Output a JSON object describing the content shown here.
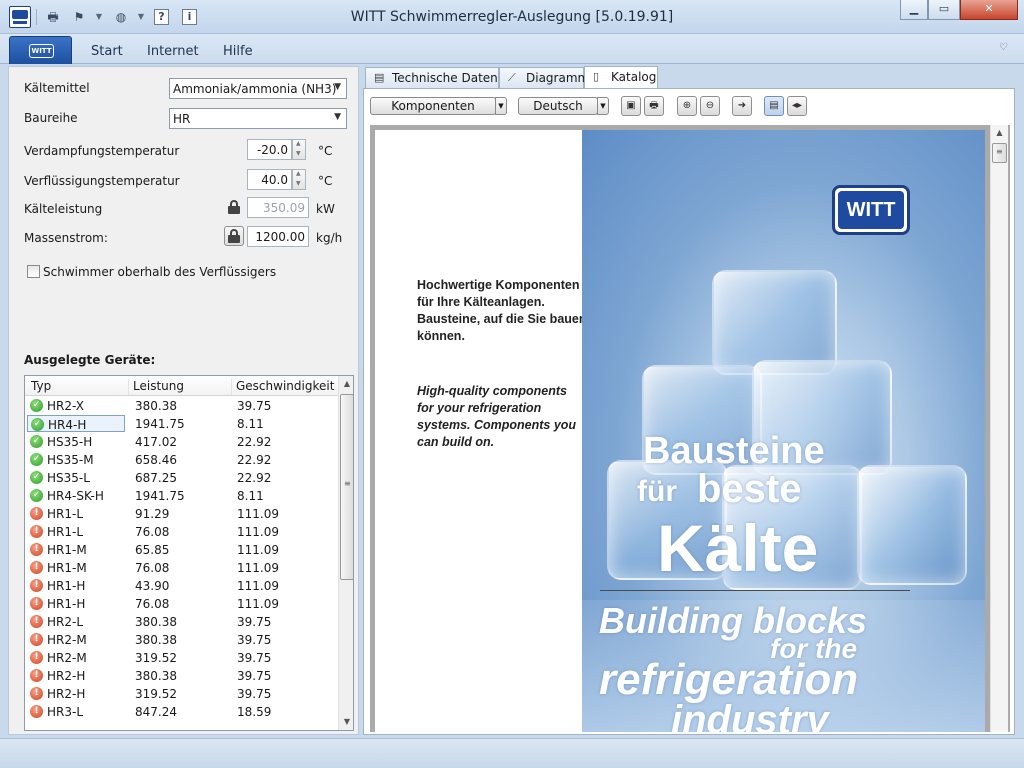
{
  "window": {
    "title": "WITT Schwimmerregler-Auslegung [5.0.19.91]"
  },
  "ribbon": {
    "app_logo": "WITT",
    "tabs": [
      "Start",
      "Internet",
      "Hilfe"
    ]
  },
  "form": {
    "kaeltemittel": {
      "label": "Kältemittel",
      "value": "Ammoniak/ammonia (NH3)"
    },
    "baureihe": {
      "label": "Baureihe",
      "value": "HR"
    },
    "verdampfung": {
      "label": "Verdampfungstemperatur",
      "value": "-20.0",
      "unit": "°C"
    },
    "verfluessigung": {
      "label": "Verflüssigungstemperatur",
      "value": "40.0",
      "unit": "°C"
    },
    "kaelteleistung": {
      "label": "Kälteleistung",
      "value": "350.09",
      "unit": "kW"
    },
    "massenstrom": {
      "label": "Massenstrom:",
      "value": "1200.00",
      "unit": "kg/h"
    },
    "schwimmer": {
      "label": "Schwimmer oberhalb des Verflüssigers",
      "checked": false
    }
  },
  "devices": {
    "title": "Ausgelegte Geräte:",
    "columns": [
      "Typ",
      "Leistung",
      "Geschwindigkeit"
    ],
    "rows": [
      {
        "typ": "HR2-X",
        "leistung": "380.38",
        "speed": "39.75",
        "status": "ok"
      },
      {
        "typ": "HR4-H",
        "leistung": "1941.75",
        "speed": "8.11",
        "status": "ok",
        "selected": true
      },
      {
        "typ": "HS35-H",
        "leistung": "417.02",
        "speed": "22.92",
        "status": "ok"
      },
      {
        "typ": "HS35-M",
        "leistung": "658.46",
        "speed": "22.92",
        "status": "ok"
      },
      {
        "typ": "HS35-L",
        "leistung": "687.25",
        "speed": "22.92",
        "status": "ok"
      },
      {
        "typ": "HR4-SK-H",
        "leistung": "1941.75",
        "speed": "8.11",
        "status": "ok"
      },
      {
        "typ": "HR1-L",
        "leistung": "91.29",
        "speed": "111.09",
        "status": "err"
      },
      {
        "typ": "HR1-L",
        "leistung": "76.08",
        "speed": "111.09",
        "status": "err"
      },
      {
        "typ": "HR1-M",
        "leistung": "65.85",
        "speed": "111.09",
        "status": "err"
      },
      {
        "typ": "HR1-M",
        "leistung": "76.08",
        "speed": "111.09",
        "status": "err"
      },
      {
        "typ": "HR1-H",
        "leistung": "43.90",
        "speed": "111.09",
        "status": "err"
      },
      {
        "typ": "HR1-H",
        "leistung": "76.08",
        "speed": "111.09",
        "status": "err"
      },
      {
        "typ": "HR2-L",
        "leistung": "380.38",
        "speed": "39.75",
        "status": "err"
      },
      {
        "typ": "HR2-M",
        "leistung": "380.38",
        "speed": "39.75",
        "status": "err"
      },
      {
        "typ": "HR2-M",
        "leistung": "319.52",
        "speed": "39.75",
        "status": "err"
      },
      {
        "typ": "HR2-H",
        "leistung": "380.38",
        "speed": "39.75",
        "status": "err"
      },
      {
        "typ": "HR2-H",
        "leistung": "319.52",
        "speed": "39.75",
        "status": "err"
      },
      {
        "typ": "HR3-L",
        "leistung": "847.24",
        "speed": "18.59",
        "status": "err"
      }
    ]
  },
  "doc_tabs": [
    {
      "label": "Technische Daten",
      "icon": "table-icon"
    },
    {
      "label": "Diagramm",
      "icon": "chart-icon"
    },
    {
      "label": "Katalog",
      "icon": "document-icon",
      "active": true
    }
  ],
  "toolbar": {
    "components": "Komponenten",
    "language": "Deutsch"
  },
  "catalog": {
    "logo": "WITT",
    "copy_de": "Hochwertige Komponenten für Ihre Kälteanlagen. Bausteine, auf die Sie bauen können.",
    "copy_en": "High-quality components for your refrigeration systems. Components you can build on.",
    "headline_de": [
      "Bausteine",
      "für",
      "beste",
      "Kälte"
    ],
    "headline_en": [
      "Building blocks",
      "for the",
      "refrigeration",
      "industry"
    ]
  }
}
